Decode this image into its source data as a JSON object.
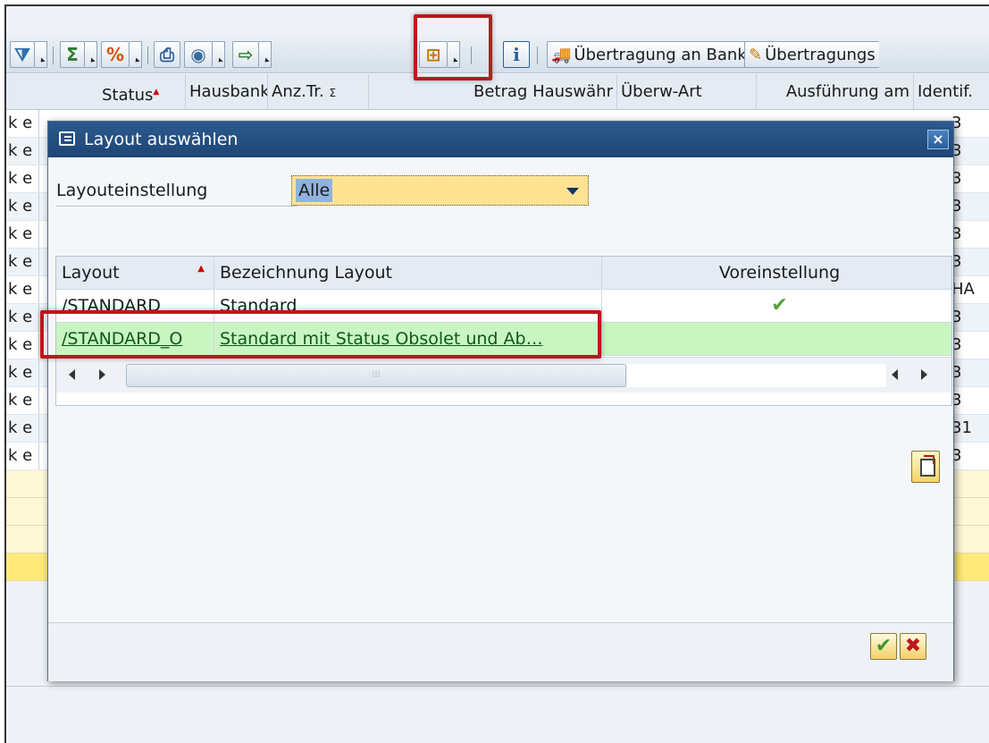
{
  "toolbar": {
    "filter_icon": "filter-icon",
    "sum_icon": "sum-icon",
    "subtotal_icon": "subtotal-icon",
    "print_icon": "print-icon",
    "view_icon": "view-icon",
    "export_icon": "export-icon",
    "layout_icon": "layout-icon",
    "info_icon": "info-icon",
    "transfer_bank_label": "Übertragung an Bank",
    "transfer_label": "Übertragungs"
  },
  "table_header": {
    "status": "Status",
    "hausbank": "Hausbank",
    "anz_tr": "Anz.Tr.",
    "sigma": "Σ",
    "betrag": "Betrag Hauswähr",
    "ueberw_art": "Überw-Art",
    "ausfuehrung": "Ausführung am",
    "identif": "Identif."
  },
  "background_rows": {
    "left_text": "k e",
    "right_values": [
      "3",
      "3",
      "3",
      "3",
      "3",
      "3",
      "HA",
      "3",
      "3",
      "3",
      "3",
      "31",
      "3"
    ]
  },
  "dialog": {
    "title": "Layout auswählen",
    "close_label": "×",
    "setting_label": "Layouteinstellung",
    "setting_value": "Alle",
    "grid": {
      "columns": [
        "Layout",
        "Bezeichnung Layout",
        "Voreinstellung"
      ],
      "rows": [
        {
          "layout": "/STANDARD",
          "description": "Standard",
          "default": "✔"
        },
        {
          "layout": "/STANDARD_O",
          "description": "Standard mit Status Obsolet und Ab…",
          "default": ""
        }
      ]
    },
    "ok_label": "✔",
    "cancel_label": "✖"
  },
  "colors": {
    "highlight_red": "#c0141c",
    "title_blue": "#1e4676",
    "selected_row_green": "#c9f5c1",
    "dropdown_yellow": "#ffe392"
  }
}
